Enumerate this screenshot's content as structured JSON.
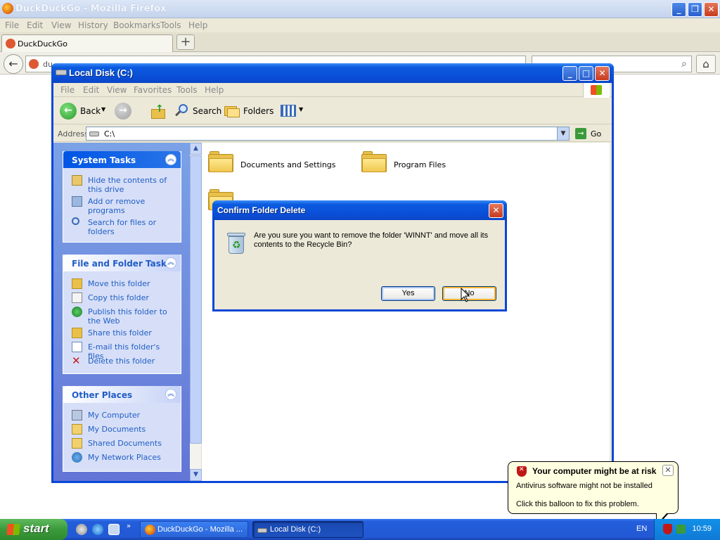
{
  "firefox": {
    "window_title": "DuckDuckGo - Mozilla Firefox",
    "menu": [
      "File",
      "Edit",
      "View",
      "History",
      "Bookmarks",
      "Tools",
      "Help"
    ],
    "tab_label": "DuckDuckGo",
    "new_tab": "+",
    "url_text": "du",
    "icons": {
      "back": "back-arrow-icon",
      "home": "home-icon",
      "search": "magnifier-icon"
    }
  },
  "explorer": {
    "title": "Local Disk (C:)",
    "menu": [
      "File",
      "Edit",
      "View",
      "Favorites",
      "Tools",
      "Help"
    ],
    "toolbar": {
      "back": "Back",
      "search": "Search",
      "folders": "Folders"
    },
    "address_label": "Address",
    "address_value": "C:\\",
    "go_label": "Go",
    "panels": {
      "system_tasks": {
        "title": "System Tasks",
        "items": [
          "Hide the contents of this drive",
          "Add or remove programs",
          "Search for files or folders"
        ]
      },
      "file_folder_tasks": {
        "title": "File and Folder Tasks",
        "items": [
          "Move this folder",
          "Copy this folder",
          "Publish this folder to the Web",
          "Share this folder",
          "E-mail this folder's files",
          "Delete this folder"
        ]
      },
      "other_places": {
        "title": "Other Places",
        "items": [
          "My Computer",
          "My Documents",
          "Shared Documents",
          "My Network Places"
        ]
      }
    },
    "folders": [
      "Documents and Settings",
      "Program Files"
    ]
  },
  "dialog": {
    "title": "Confirm Folder Delete",
    "message": "Are you sure you want to remove the folder 'WINNT' and move all its contents to the Recycle Bin?",
    "yes": "Yes",
    "no": "No"
  },
  "taskbar": {
    "start": "start",
    "tasks": [
      "DuckDuckGo - Mozilla ...",
      "Local Disk (C:)"
    ],
    "language": "EN",
    "clock": "10:59"
  },
  "balloon": {
    "title": "Your computer might be at risk",
    "line1": "Antivirus software might not be installed",
    "line2": "Click this balloon to fix this problem."
  },
  "colors": {
    "xp_blue": "#0a46d8",
    "taskbar_blue": "#245edb",
    "start_green": "#3a9a3a",
    "link_blue": "#215dc6"
  }
}
